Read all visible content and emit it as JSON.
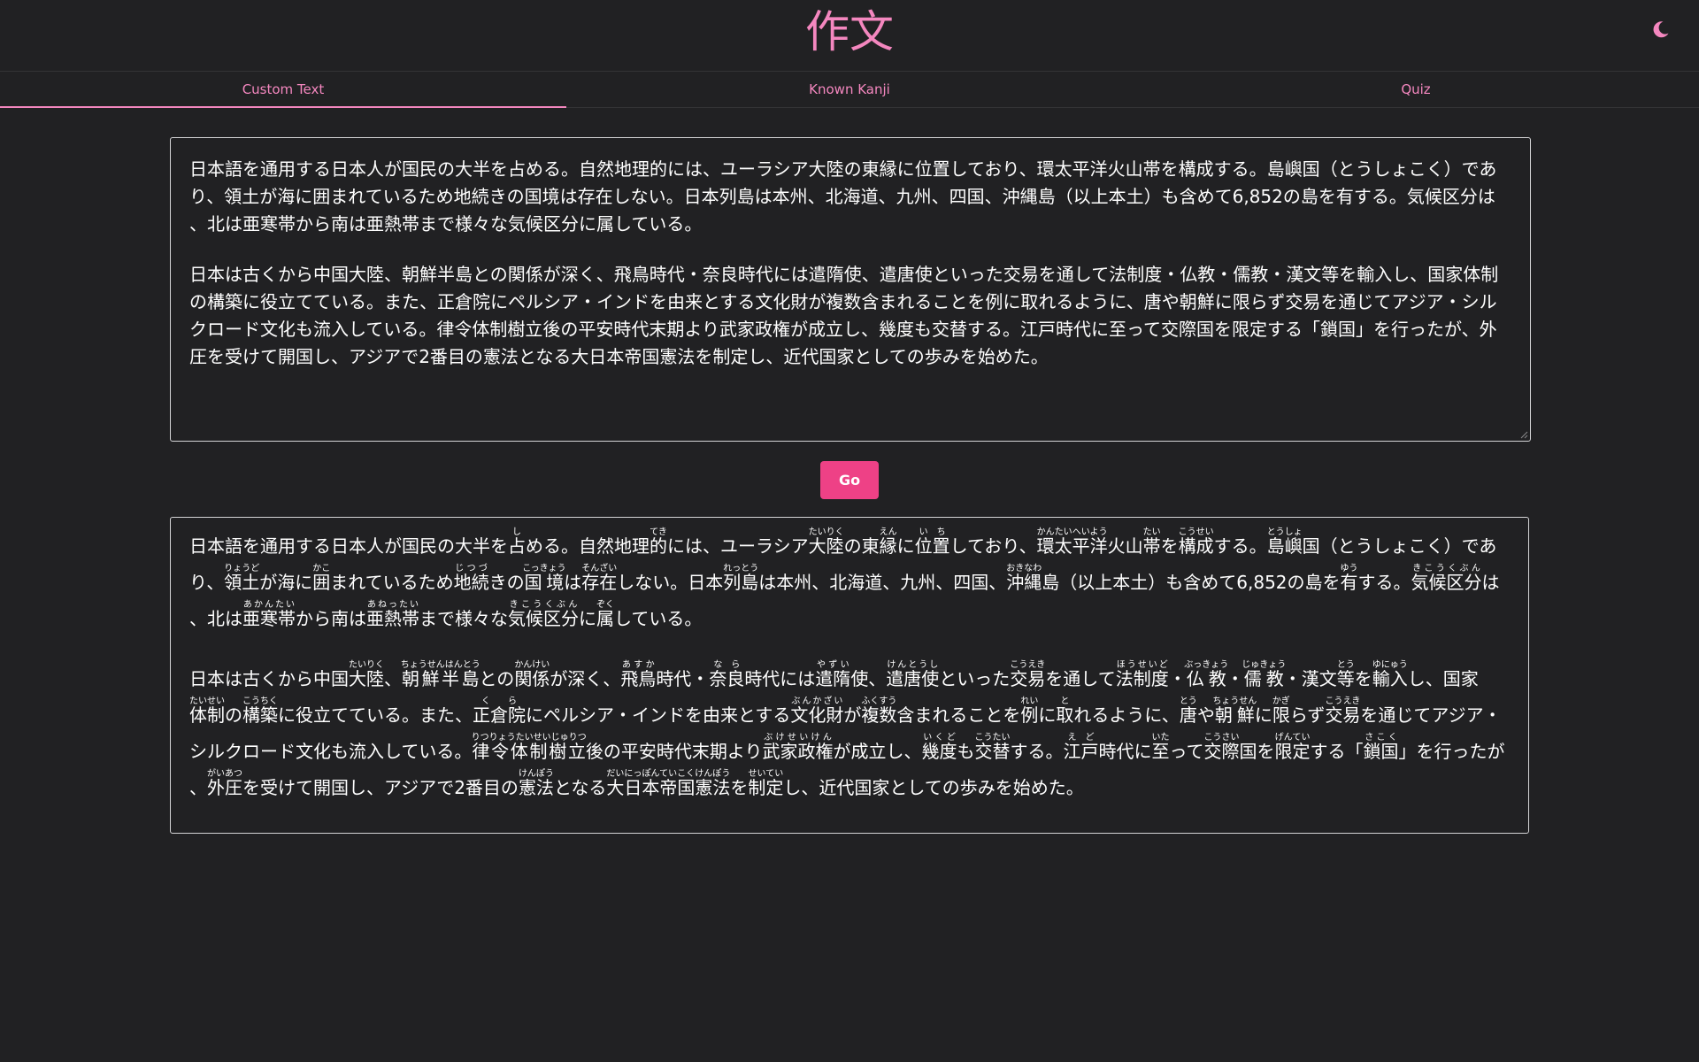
{
  "header": {
    "title": "作文",
    "theme_icon": "moon-icon",
    "accent_color": "#f487bf"
  },
  "tabs": [
    {
      "label": "Custom Text",
      "active": true
    },
    {
      "label": "Known Kanji",
      "active": false
    },
    {
      "label": "Quiz",
      "active": false
    }
  ],
  "input": {
    "paragraphs": [
      "日本語を通用する日本人が国民の大半を占める。自然地理的には、ユーラシア大陸の東縁に位置しており、環太平洋火山帯を構成する。島嶼国（とうしょこく）であり、領土が海に囲まれているため地続きの国境は存在しない。日本列島は本州、北海道、九州、四国、沖縄島（以上本土）も含めて6,852の島を有する。気候区分は、北は亜寒帯から南は亜熱帯まで様々な気候区分に属している。",
      "日本は古くから中国大陸、朝鮮半島との関係が深く、飛鳥時代・奈良時代には遣隋使、遣唐使といった交易を通して法制度・仏教・儒教・漢文等を輸入し、国家体制の構築に役立てている。また、正倉院にペルシア・インドを由来とする文化財が複数含まれることを例に取れるように、唐や朝鮮に限らず交易を通じてアジア・シルクロード文化も流入している。律令体制樹立後の平安時代末期より武家政権が成立し、幾度も交替する。江戸時代に至って交際国を限定する「鎖国」を行ったが、外圧を受けて開国し、アジアで2番目の憲法となる大日本帝国憲法を制定し、近代国家としての歩みを始めた。"
    ]
  },
  "go_button": {
    "label": "Go",
    "color": "#ee4186"
  },
  "output": {
    "paragraphs": [
      [
        [
          "日本語を通用する日本人が国民の大半を"
        ],
        [
          "占",
          "し"
        ],
        [
          "める。自然地理"
        ],
        [
          "的",
          "てき"
        ],
        [
          "には、ユーラシア"
        ],
        [
          "大陸",
          "たいりく"
        ],
        [
          "の東"
        ],
        [
          "縁",
          "えん"
        ],
        [
          "に"
        ],
        [
          "位置",
          "いち"
        ],
        [
          "しており、"
        ],
        [
          "環太平洋",
          "かんたいへいよう"
        ],
        [
          "火山"
        ],
        [
          "帯",
          "たい"
        ],
        [
          "を"
        ],
        [
          "構成",
          "こうせい"
        ],
        [
          "する。"
        ],
        [
          "島嶼",
          "とうしょ"
        ],
        [
          "国（とうしょこく）であり、"
        ],
        [
          "領土",
          "りょうど"
        ],
        [
          "が海に"
        ],
        [
          "囲",
          "かこ"
        ],
        [
          "まれているため"
        ],
        [
          "地続",
          "じつづ"
        ],
        [
          "きの"
        ],
        [
          "国境",
          "こっきょう"
        ],
        [
          "は"
        ],
        [
          "存在",
          "そんざい"
        ],
        [
          "しない。日本"
        ],
        [
          "列島",
          "れっとう"
        ],
        [
          "は本州、北海道、九州、四国、"
        ],
        [
          "沖縄",
          "おきなわ"
        ],
        [
          "島（以上本土）も含めて6,852の島を"
        ],
        [
          "有",
          "ゆう"
        ],
        [
          "する。"
        ],
        [
          "気候区分",
          "きこうくぶん"
        ],
        [
          "は、北は"
        ],
        [
          "亜寒帯",
          "あかんたい"
        ],
        [
          "から南は"
        ],
        [
          "亜熱帯",
          "あねったい"
        ],
        [
          "まで様々な"
        ],
        [
          "気候区分",
          "きこうくぶん"
        ],
        [
          "に"
        ],
        [
          "属",
          "ぞく"
        ],
        [
          "している。"
        ]
      ],
      [
        [
          "日本は古くから中国"
        ],
        [
          "大陸",
          "たいりく"
        ],
        [
          "、"
        ],
        [
          "朝鮮半島",
          "ちょうせんはんとう"
        ],
        [
          "との"
        ],
        [
          "関係",
          "かんけい"
        ],
        [
          "が深く、"
        ],
        [
          "飛鳥",
          "あすか"
        ],
        [
          "時代・"
        ],
        [
          "奈良",
          "なら"
        ],
        [
          "時代には"
        ],
        [
          "遣隋",
          "やずい"
        ],
        [
          "使、"
        ],
        [
          "遣唐使",
          "けんとうし"
        ],
        [
          "といった"
        ],
        [
          "交易",
          "こうえき"
        ],
        [
          "を通して"
        ],
        [
          "法制度",
          "ほうせいど"
        ],
        [
          "・"
        ],
        [
          "仏教",
          "ぶっきょう"
        ],
        [
          "・"
        ],
        [
          "儒教",
          "じゅきょう"
        ],
        [
          "・漢文"
        ],
        [
          "等",
          "とう"
        ],
        [
          "を"
        ],
        [
          "輸入",
          "ゆにゅう"
        ],
        [
          "し、国家"
        ],
        [
          "体制",
          "たいせい"
        ],
        [
          "の"
        ],
        [
          "構築",
          "こうちく"
        ],
        [
          "に役立てている。また、"
        ],
        [
          "正倉院",
          "くら"
        ],
        [
          "にペルシア・インドを由来とする"
        ],
        [
          "文化財",
          "ぶんかざい"
        ],
        [
          "が"
        ],
        [
          "複数",
          "ふくすう"
        ],
        [
          "含まれることを"
        ],
        [
          "例",
          "れい"
        ],
        [
          "に"
        ],
        [
          "取",
          "と"
        ],
        [
          "れるように、"
        ],
        [
          "唐",
          "とう"
        ],
        [
          "や"
        ],
        [
          "朝鮮",
          "ちょうせん"
        ],
        [
          "に"
        ],
        [
          "限",
          "かぎ"
        ],
        [
          "らず"
        ],
        [
          "交易",
          "こうえき"
        ],
        [
          "を通じてアジア・シルクロード文化も流入している。"
        ],
        [
          "律令体制樹立",
          "りつりょうたいせいじゅりつ"
        ],
        [
          "後の平安時代末期より"
        ],
        [
          "武家政権",
          "ぶけせいけん"
        ],
        [
          "が成立し、"
        ],
        [
          "幾度",
          "いくど"
        ],
        [
          "も"
        ],
        [
          "交替",
          "こうたい"
        ],
        [
          "する。"
        ],
        [
          "江戸",
          "えど"
        ],
        [
          "時代に"
        ],
        [
          "至",
          "いた"
        ],
        [
          "って"
        ],
        [
          "交際",
          "こうさい"
        ],
        [
          "国を"
        ],
        [
          "限定",
          "げんてい"
        ],
        [
          "する「"
        ],
        [
          "鎖国",
          "さこく"
        ],
        [
          "」を行ったが、"
        ],
        [
          "外圧",
          "がいあつ"
        ],
        [
          "を受けて開国し、アジアで2番目の"
        ],
        [
          "憲法",
          "けんぽう"
        ],
        [
          "となる"
        ],
        [
          "大日本帝国憲法",
          "だいにっぽんていこくけんぽう"
        ],
        [
          "を"
        ],
        [
          "制定",
          "せいてい"
        ],
        [
          "し、近代国家としての歩みを始めた。"
        ]
      ]
    ]
  }
}
